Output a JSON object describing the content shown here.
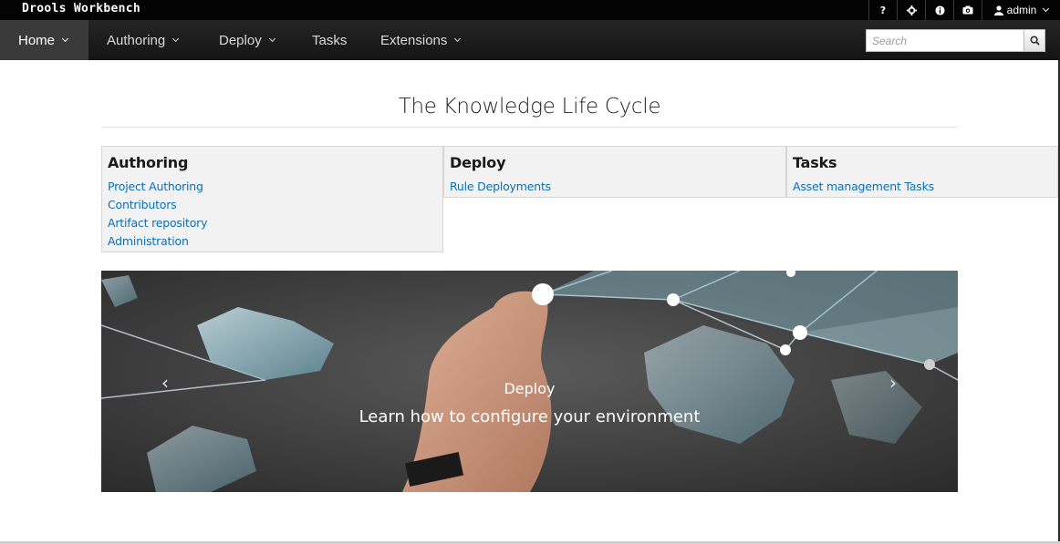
{
  "app": {
    "brand": "Drools Workbench"
  },
  "topbar": {
    "icons": [
      "help-icon",
      "gear-icon",
      "info-icon",
      "camera-icon"
    ],
    "help_label": "?",
    "user_label": "admin"
  },
  "nav": {
    "items": [
      {
        "label": "Home",
        "has_dropdown": true,
        "active": true
      },
      {
        "label": "Authoring",
        "has_dropdown": true,
        "active": false
      },
      {
        "label": "Deploy",
        "has_dropdown": true,
        "active": false
      },
      {
        "label": "Tasks",
        "has_dropdown": false,
        "active": false
      },
      {
        "label": "Extensions",
        "has_dropdown": true,
        "active": false
      }
    ],
    "search_placeholder": "Search"
  },
  "main": {
    "title": "The Knowledge Life Cycle",
    "panels": [
      {
        "title": "Authoring",
        "links": [
          "Project Authoring",
          "Contributors",
          "Artifact repository",
          "Administration"
        ]
      },
      {
        "title": "Deploy",
        "links": [
          "Rule Deployments"
        ]
      },
      {
        "title": "Tasks",
        "links": [
          "Asset management Tasks"
        ]
      }
    ],
    "carousel": {
      "title": "Deploy",
      "text": "Learn how to configure your environment",
      "prev_icon": "chevron-left-icon",
      "next_icon": "chevron-right-icon"
    }
  },
  "colors": {
    "link": "#0a6fb8",
    "topbar": "#030303",
    "navbar": "#1b1b1b",
    "panel_bg": "#f2f2f2"
  }
}
